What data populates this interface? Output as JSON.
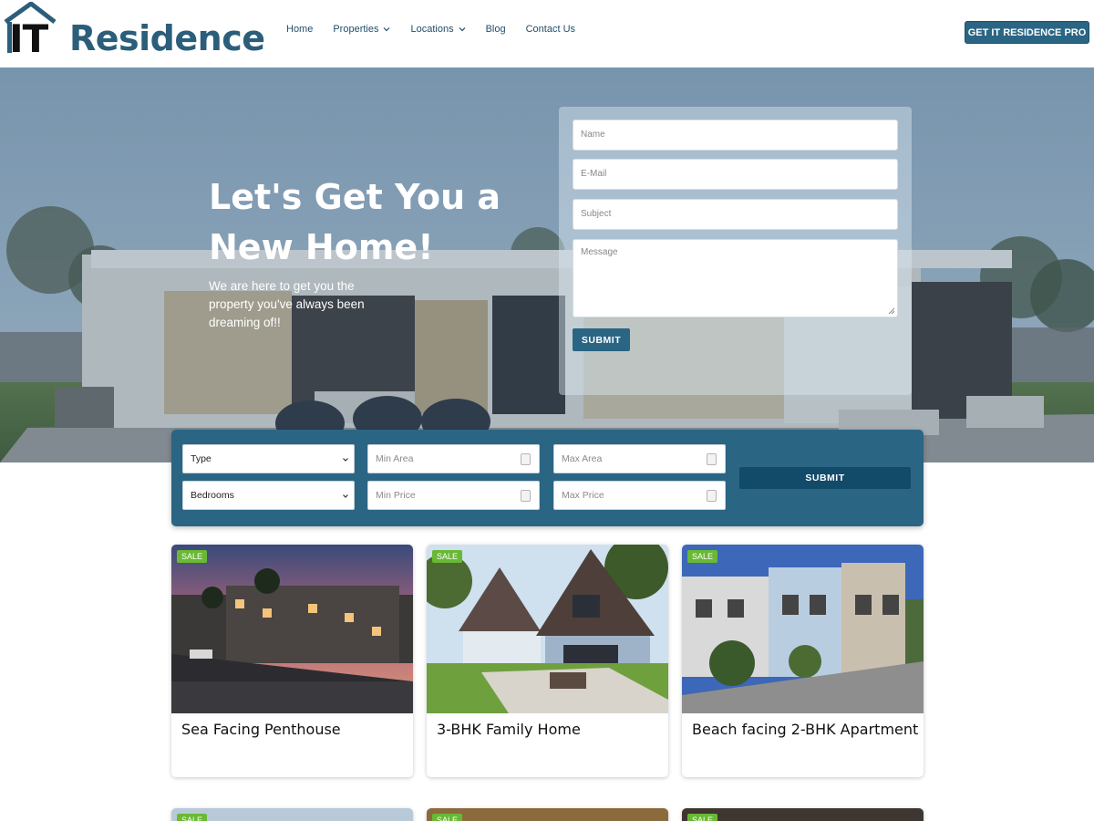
{
  "header": {
    "logo_it": "IT",
    "logo_word": "Residence",
    "nav": [
      {
        "label": "Home"
      },
      {
        "label": "Properties"
      },
      {
        "label": "Locations"
      },
      {
        "label": "Blog"
      },
      {
        "label": "Contact Us"
      }
    ],
    "pro_button": "GET IT RESIDENCE PRO"
  },
  "hero": {
    "title": "Let's Get You a New Home!",
    "subtitle": "We are here to get you the property you've always been dreaming of!!"
  },
  "contact_form": {
    "name_placeholder": "Name",
    "email_placeholder": "E-Mail",
    "subject_placeholder": "Subject",
    "message_placeholder": "Message",
    "submit": "SUBMIT"
  },
  "search": {
    "type": "Type",
    "bedrooms": "Bedrooms",
    "min_area": "Min Area",
    "max_area": "Max Area",
    "min_price": "Min Price",
    "max_price": "Max Price",
    "submit": "SUBMIT"
  },
  "listings": [
    {
      "badge": "SALE",
      "title": "Sea Facing Penthouse"
    },
    {
      "badge": "SALE",
      "title": "3-BHK Family Home"
    },
    {
      "badge": "SALE",
      "title": "Beach facing 2-BHK Apartment"
    }
  ],
  "listings_row2": [
    {
      "badge": "SALE"
    },
    {
      "badge": "SALE"
    },
    {
      "badge": "SALE"
    }
  ],
  "colors": {
    "brand": "#2b6584",
    "brand_dark": "#124a69",
    "badge": "#69b934"
  },
  "icons": {
    "logo": "house-roof-icon",
    "nav_dropdown": "chevron-down-icon",
    "select_caret": "chevron-down-icon",
    "number_spinner": "spinner-icon"
  }
}
